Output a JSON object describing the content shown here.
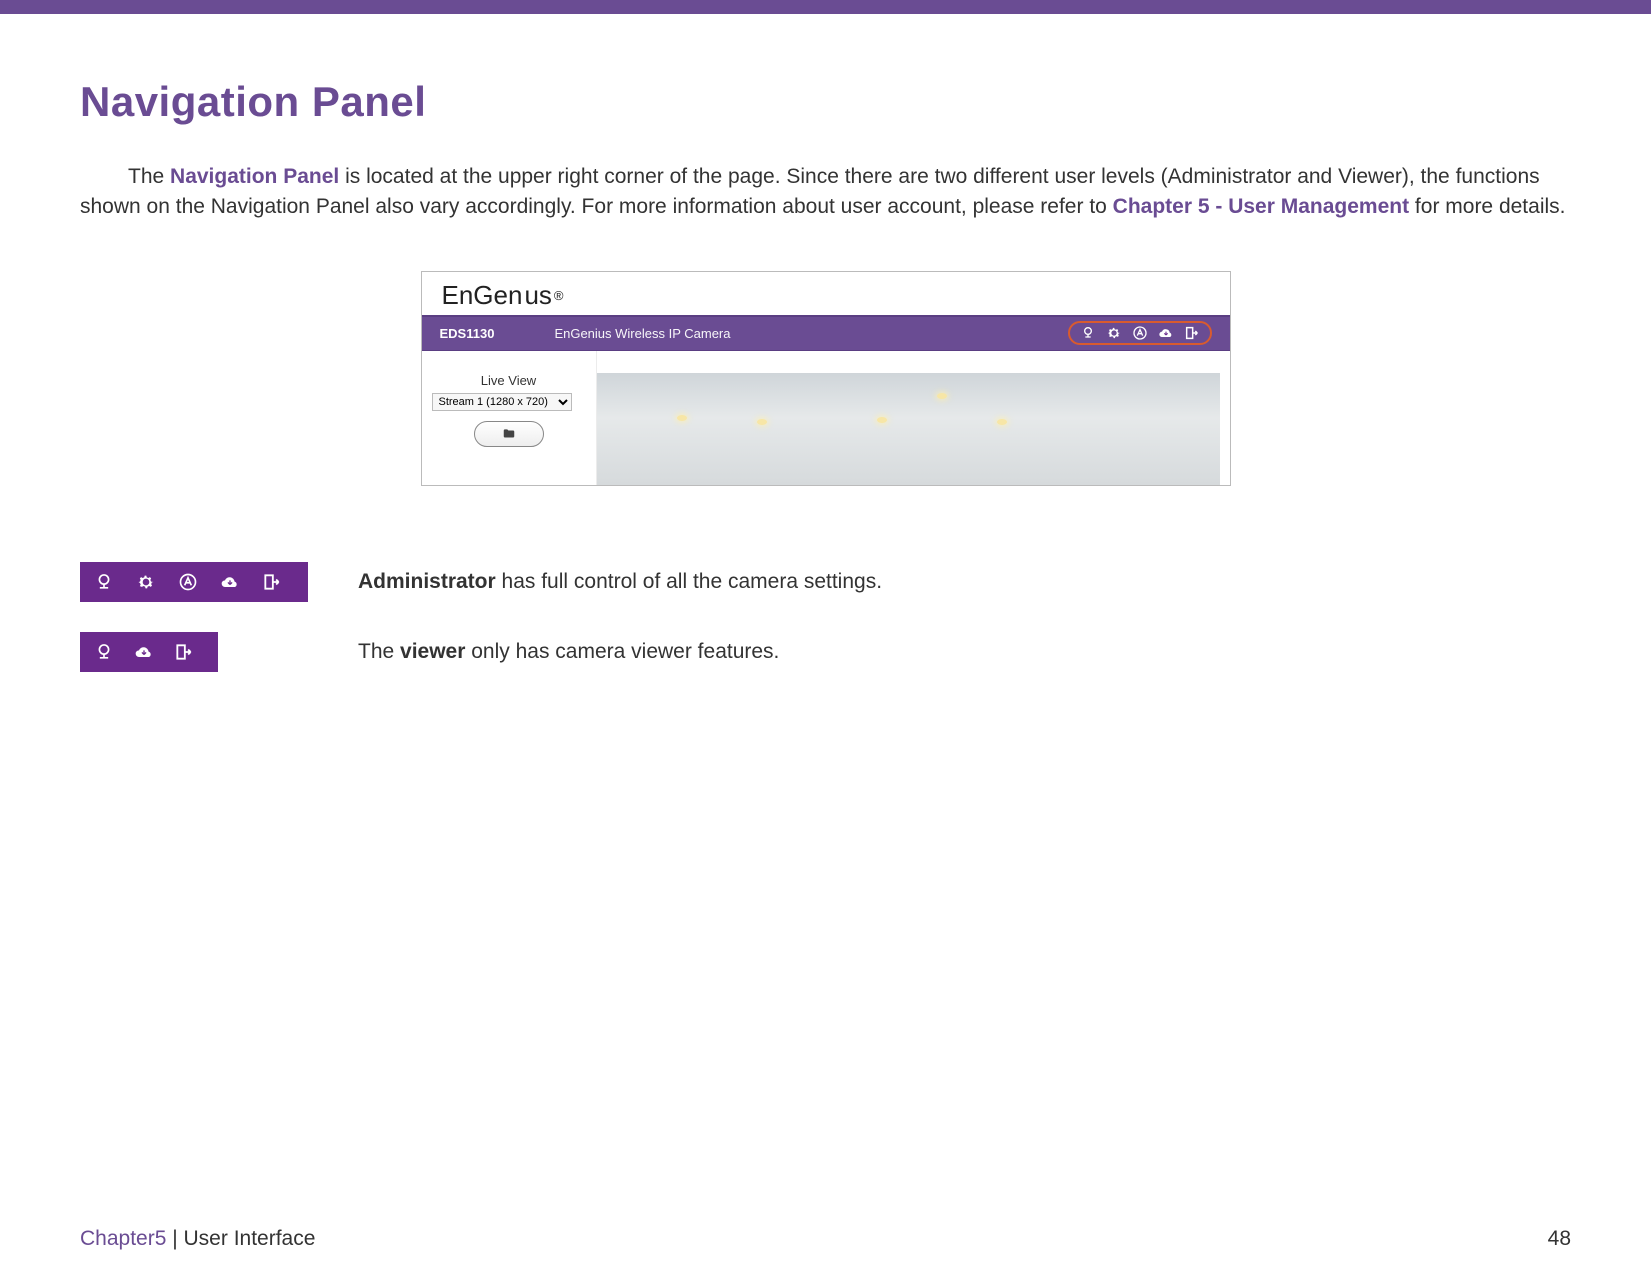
{
  "heading": "Navigation Panel",
  "paragraph": {
    "part1": "The ",
    "em1": "Navigation Panel",
    "part2": " is located at the upper right corner of the page. Since there are two different user levels (Administrator and Viewer), the functions shown on the Navigation Panel also vary accordingly. For more information about user account, please refer to ",
    "em2": "Chapter 5 - User Management",
    "part3": " for more details."
  },
  "screenshot": {
    "logo_prefix": "EnGen",
    "logo_suffix": "us",
    "logo_reg": "®",
    "model": "EDS1130",
    "title": "EnGenius Wireless IP Camera",
    "live_view_label": "Live View",
    "stream_option": "Stream 1 (1280 x 720)"
  },
  "roles": {
    "admin": {
      "label": "Administrator",
      "text": " has full control of all the camera settings."
    },
    "viewer": {
      "prefix": "The ",
      "label": "viewer",
      "text": " only has camera viewer features."
    }
  },
  "footer": {
    "chapter": "Chapter5",
    "separator": "  |  ",
    "section": "User Interface",
    "page": "48"
  }
}
